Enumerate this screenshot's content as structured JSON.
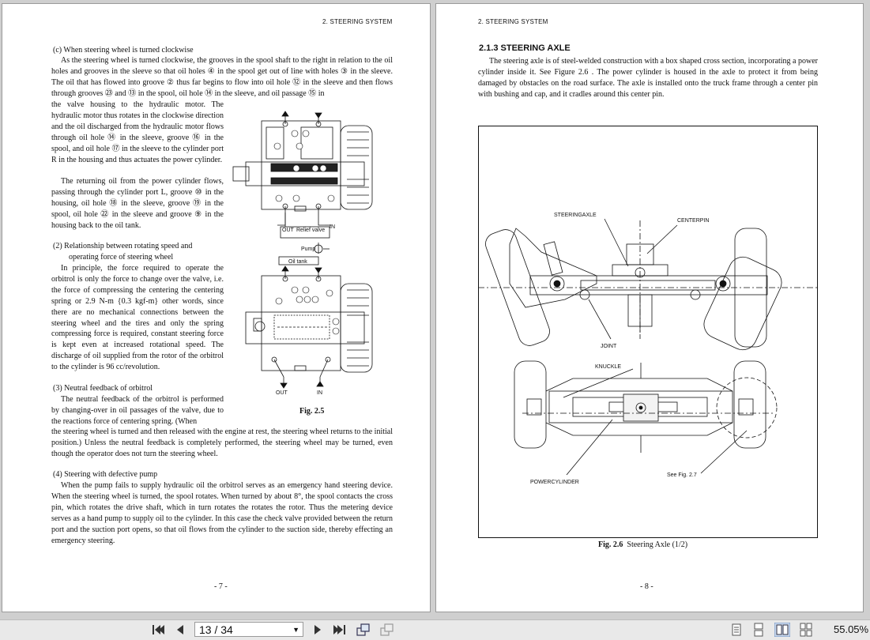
{
  "viewer": {
    "page_indicator": "13 / 34",
    "zoom": "55.05%"
  },
  "left_page": {
    "running_head": "2.  STEERING SYSTEM",
    "page_number": "- 7 -",
    "c_heading": "(c)  When steering wheel is turned clockwise",
    "c_para1": "As the steering wheel is turned clockwise, the grooves in the spool shaft to the right in relation to the oil holes and grooves in the sleeve so that oil holes ④ in the spool get out of line with holes ③ in the sleeve.  The oil that has flowed into groove ② thus far begins to flow into oil hole ⑫ in the sleeve and then flows through grooves ㉓ and ⑬ in the spool, oil hole ⑭ in the sleeve, and oil passage ⑮ in",
    "c_para1_cont": "the valve housing to the hydraulic motor.  The hydraulic motor thus rotates in the clockwise direction and the oil discharged from the hydraulic motor flows through oil hole ⑭ in the sleeve, groove ⑯ in the spool, and oil hole ⑰ in the sleeve to the cylinder port R in the housing and thus actuates the power cylinder.",
    "c_para2": "The returning oil from the power cylinder flows, passing through the cylinder port L, groove ⑩ in the housing, oil hole ⑱ in the sleeve, groove ⑲ in the spool, oil hole ㉒ in the sleeve and groove ⑨ in the housing back to the oil tank.",
    "s2_heading_line1": "(2)  Relationship between rotating speed and",
    "s2_heading_line2": "operating force of steering wheel",
    "s2_para": "In principle, the force required to operate the orbitrol is only the force to change over the valve, i.e. the force of compressing the centering the centering spring or 2.9 N-m {0.3 kgf-m} other words, since there are no mechanical connections between the steering wheel and the tires and only the spring compressing force is required, constant steering force is kept even at increased rotational speed.  The discharge of oil supplied from the rotor of the orbitrol to the cylinder is 96 cc/revolution.",
    "s3_heading": "(3)  Neutral feedback of orbitrol",
    "s3_para_a": "The neutral feedback of the orbitrol is performed by changing-over in oil passages of the valve, due to the reactions force of centering spring.  (When",
    "s3_para_b": "the steering wheel is turned and then released with the engine at rest, the steering wheel returns to the initial position.)  Unless the neutral feedback is completely performed, the steering wheel may be turned, even though the operator does not turn the steering wheel.",
    "s4_heading": "(4)  Steering with defective pump",
    "s4_para": "When the pump fails to supply hydraulic oil the orbitrol serves as an emergency hand steering device.  When the steering wheel is turned, the spool rotates.  When turned by about 8°, the spool contacts the cross pin, which rotates the drive shaft, which in turn rotates the rotates the rotor.  Thus the metering device serves as a hand pump to supply oil to the cylinder.  In this case the check valve provided between the return port and the suction port opens, so that oil flows from the cylinder to the suction side, thereby effecting an emergency steering.",
    "fig25_caption": "Fig. 2.5",
    "fig25_labels": {
      "out": "OUT",
      "in": "IN",
      "relief_valve": "Relief valve",
      "pump": "Pump",
      "oil_tank": "Oil tank"
    }
  },
  "right_page": {
    "running_head": "2.  STEERING SYSTEM",
    "page_number": "- 8 -",
    "section_title": "2.1.3  STEERING AXLE",
    "para": "The steering axle is of steel-welded construction with a box shaped cross section, incorporating a power cylinder inside it. See Figure 2.6 . The power cylinder is housed in the axle to protect it from being damaged by obstacles on the road surface. The axle is installed onto the truck frame through a center pin with bushing and cap, and it cradles around this center pin.",
    "fig26_caption_bold": "Fig. 2.6",
    "fig26_caption_text": "Steering Axle (1/2)",
    "fig26_labels": {
      "steering_axle": "STEERINGAXLE",
      "centerpin": "CENTERPIN",
      "joint": "JOINT",
      "knuckle": "KNUCKLE",
      "power_cylinder": "POWERCYLINDER",
      "see_fig": "See Fig. 2.7"
    }
  }
}
